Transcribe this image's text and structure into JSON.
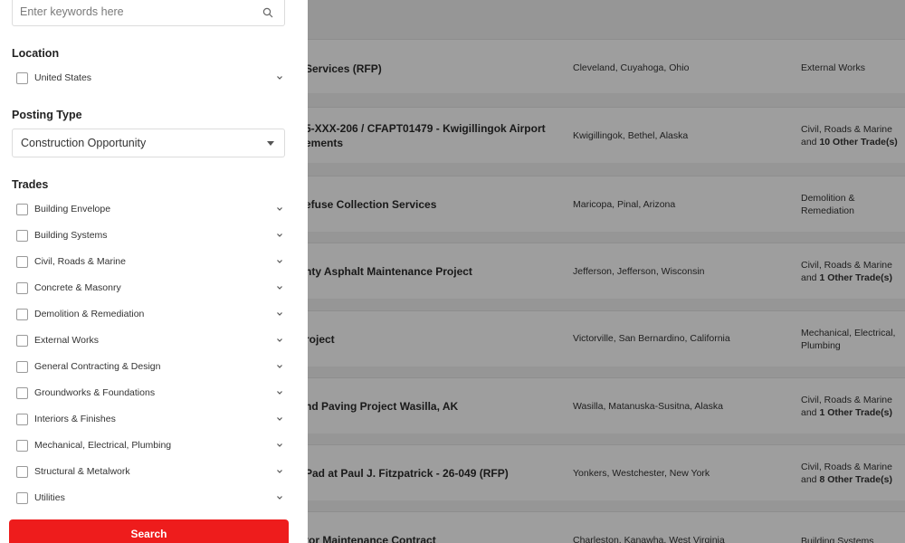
{
  "filters": {
    "search": {
      "placeholder": "Enter keywords here",
      "value": ""
    },
    "location": {
      "label": "Location",
      "items": [
        {
          "label": "United States"
        }
      ]
    },
    "posting_type": {
      "label": "Posting Type",
      "selected": "Construction Opportunity"
    },
    "trades": {
      "label": "Trades",
      "items": [
        {
          "label": "Building Envelope"
        },
        {
          "label": "Building Systems"
        },
        {
          "label": "Civil, Roads & Marine"
        },
        {
          "label": "Concrete & Masonry"
        },
        {
          "label": "Demolition & Remediation"
        },
        {
          "label": "External Works"
        },
        {
          "label": "General Contracting & Design"
        },
        {
          "label": "Groundworks & Foundations"
        },
        {
          "label": "Interiors & Finishes"
        },
        {
          "label": "Mechanical, Electrical, Plumbing"
        },
        {
          "label": "Structural & Metalwork"
        },
        {
          "label": "Utilities"
        }
      ]
    },
    "search_button_label": "Search"
  },
  "listings": [
    {
      "title": "Services (RFP)",
      "location": "Cleveland, Cuyahoga, Ohio",
      "trade": "External Works",
      "trade_extra": ""
    },
    {
      "title": "5-XXX-206 / CFAPT01479 - Kwigillingok Airport",
      "title_line2": "ements",
      "location": "Kwigillingok, Bethel, Alaska",
      "trade": "Civil, Roads & Marine and ",
      "trade_extra": "10 Other Trade(s)"
    },
    {
      "title": "efuse Collection Services",
      "location": "Maricopa, Pinal, Arizona",
      "trade": "Demolition & Remediation",
      "trade_extra": ""
    },
    {
      "title": "nty Asphalt Maintenance Project",
      "location": "Jefferson, Jefferson, Wisconsin",
      "trade": "Civil, Roads & Marine and ",
      "trade_extra": "1 Other Trade(s)"
    },
    {
      "title": "roject",
      "location": "Victorville, San Bernardino, California",
      "trade": "Mechanical, Electrical, Plumbing",
      "trade_extra": ""
    },
    {
      "title": "nd Paving Project Wasilla, AK",
      "location": "Wasilla, Matanuska-Susitna, Alaska",
      "trade": "Civil, Roads & Marine and ",
      "trade_extra": "1 Other Trade(s)"
    },
    {
      "title": " Pad at Paul J. Fitzpatrick - 26-049 (RFP)",
      "location": "Yonkers, Westchester, New York",
      "trade": "Civil, Roads & Marine and ",
      "trade_extra": "8 Other Trade(s)"
    },
    {
      "title": "tor Maintenance Contract",
      "location": "Charleston, Kanawha, West Virginia",
      "trade": "Building Systems",
      "trade_extra": ""
    }
  ]
}
